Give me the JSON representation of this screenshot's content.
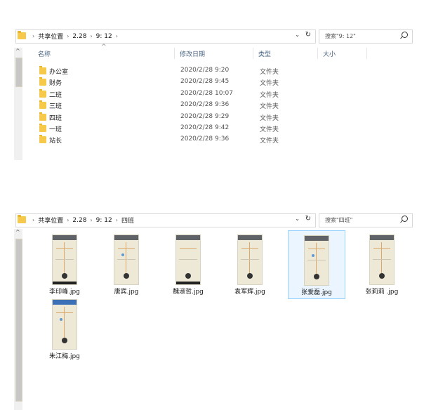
{
  "window1": {
    "breadcrumb": [
      "共享位置",
      "2.28",
      "9: 12"
    ],
    "search_placeholder": "搜索\"9: 12\"",
    "columns": {
      "name": "名称",
      "date": "修改日期",
      "type": "类型",
      "size": "大小"
    },
    "rows": [
      {
        "name": "办公室",
        "date": "2020/2/28 9:20",
        "type": "文件夹"
      },
      {
        "name": "财务",
        "date": "2020/2/28 9:45",
        "type": "文件夹"
      },
      {
        "name": "二班",
        "date": "2020/2/28 10:07",
        "type": "文件夹"
      },
      {
        "name": "三班",
        "date": "2020/2/28 9:36",
        "type": "文件夹"
      },
      {
        "name": "四班",
        "date": "2020/2/28 9:29",
        "type": "文件夹"
      },
      {
        "name": "一班",
        "date": "2020/2/28 9:42",
        "type": "文件夹"
      },
      {
        "name": "站长",
        "date": "2020/2/28 9:36",
        "type": "文件夹"
      }
    ]
  },
  "window2": {
    "breadcrumb": [
      "共享位置",
      "2.28",
      "9: 12",
      "四班"
    ],
    "search_placeholder": "搜索\"四班\"",
    "files": [
      {
        "name": "李印峰.jpg"
      },
      {
        "name": "唐宾.jpg"
      },
      {
        "name": "魏淑哲.jpg"
      },
      {
        "name": "袁军辉.jpg"
      },
      {
        "name": "张爱磊.jpg",
        "selected": true
      },
      {
        "name": "张莉莉 .jpg"
      },
      {
        "name": "朱江梅.jpg"
      }
    ]
  },
  "icons": {
    "folder": "folder-icon",
    "chevron": "chevron-right-icon",
    "dropdown": "chevron-down-icon",
    "refresh": "refresh-icon",
    "search": "search-icon"
  }
}
